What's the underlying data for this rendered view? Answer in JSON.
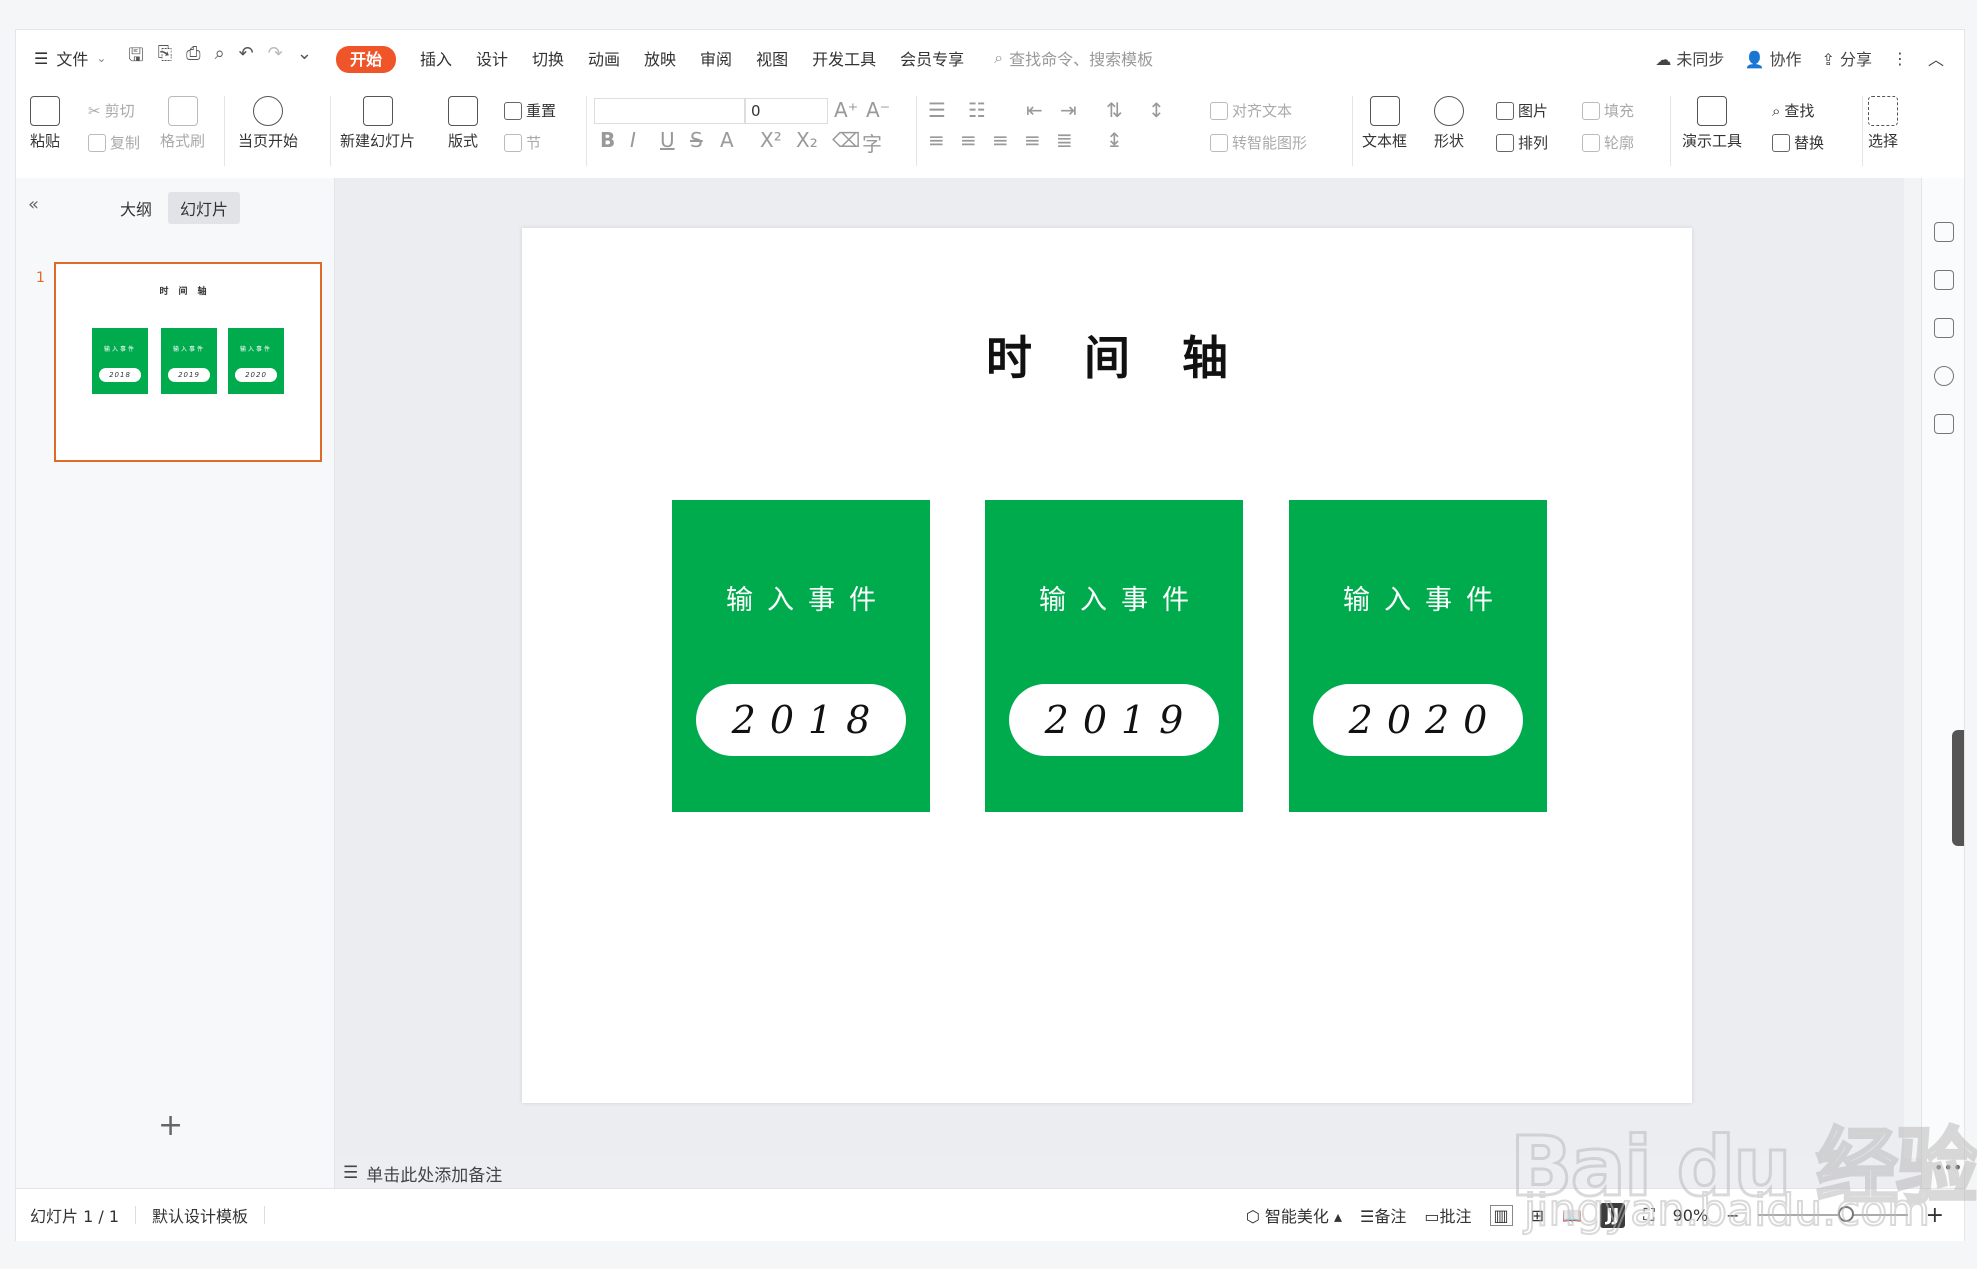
{
  "menubar": {
    "file_label": "文件",
    "tabs": [
      "开始",
      "插入",
      "设计",
      "切换",
      "动画",
      "放映",
      "审阅",
      "视图",
      "开发工具",
      "会员专享"
    ],
    "active_tab": "开始",
    "search_placeholder": "查找命令、搜索模板",
    "sync_label": "未同步",
    "collab_label": "协作",
    "share_label": "分享"
  },
  "ribbon": {
    "paste": "粘贴",
    "cut": "剪切",
    "copy": "复制",
    "format_painter": "格式刷",
    "play_current": "当页开始",
    "new_slide": "新建幻灯片",
    "layout": "版式",
    "reset": "重置",
    "section": "节",
    "font_size": "0",
    "align_text": "对齐文本",
    "smartart": "转智能图形",
    "textbox": "文本框",
    "shape": "形状",
    "picture": "图片",
    "arrange": "排列",
    "fill": "填充",
    "outline": "轮廓",
    "present_tools": "演示工具",
    "find": "查找",
    "replace": "替换",
    "select": "选择"
  },
  "leftpanel": {
    "tab_outline": "大纲",
    "tab_slides": "幻灯片",
    "active_tab": "幻灯片",
    "slide_number": "1"
  },
  "slide": {
    "title": "时间轴",
    "cards": [
      {
        "event": "输入事件",
        "year": "2018"
      },
      {
        "event": "输入事件",
        "year": "2019"
      },
      {
        "event": "输入事件",
        "year": "2020"
      }
    ],
    "card_color": "#00ab4e"
  },
  "notes_placeholder": "单击此处添加备注",
  "status": {
    "slide_count": "幻灯片 1 / 1",
    "template": "默认设计模板",
    "beautify": "智能美化",
    "notes": "备注",
    "comments": "批注",
    "zoom": "90%"
  },
  "watermark": {
    "brand": "Bai du 经验",
    "url": "jingyan.baidu.com"
  },
  "colors": {
    "accent": "#f0552a",
    "selection": "#e06a2a"
  }
}
